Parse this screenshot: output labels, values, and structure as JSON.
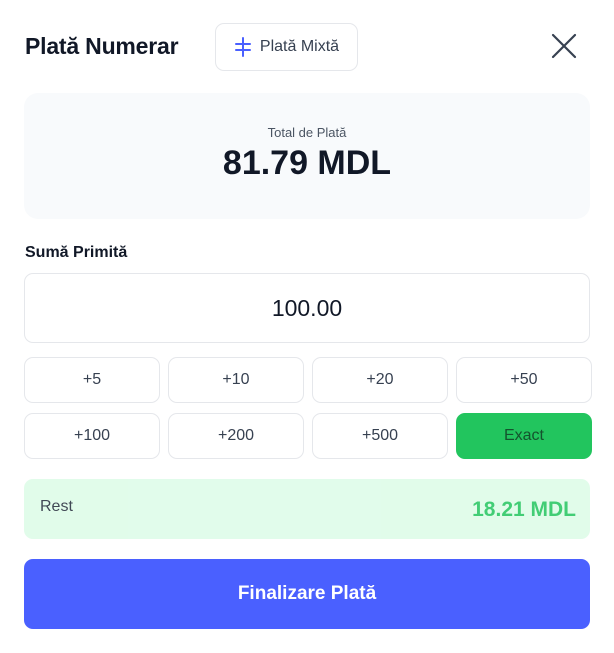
{
  "header": {
    "title": "Plată Numerar",
    "mixed_payment_label": "Plată Mixtă",
    "mixed_payment_icon": "split-icon",
    "close_icon": "close-icon"
  },
  "total": {
    "label": "Total de Plată",
    "value": "81.79 MDL"
  },
  "received": {
    "label": "Sumă Primită",
    "value": "100.00"
  },
  "quick_amounts": [
    "+5",
    "+10",
    "+20",
    "+50",
    "+100",
    "+200",
    "+500",
    "Exact"
  ],
  "change": {
    "label": "Rest",
    "value": "18.21 MDL"
  },
  "finalize_label": "Finalizare Plată",
  "colors": {
    "accent": "#4a60ff",
    "success": "#22c55e",
    "success_bg": "#dcfce7",
    "card_bg": "#f8fafc"
  }
}
